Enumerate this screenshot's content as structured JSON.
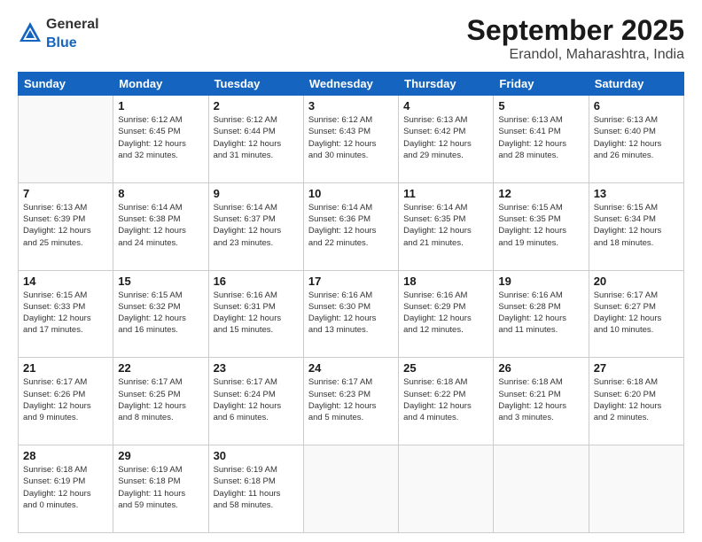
{
  "header": {
    "logo_general": "General",
    "logo_blue": "Blue",
    "title": "September 2025",
    "subtitle": "Erandol, Maharashtra, India"
  },
  "days_of_week": [
    "Sunday",
    "Monday",
    "Tuesday",
    "Wednesday",
    "Thursday",
    "Friday",
    "Saturday"
  ],
  "weeks": [
    [
      {
        "day": "",
        "info": ""
      },
      {
        "day": "1",
        "info": "Sunrise: 6:12 AM\nSunset: 6:45 PM\nDaylight: 12 hours\nand 32 minutes."
      },
      {
        "day": "2",
        "info": "Sunrise: 6:12 AM\nSunset: 6:44 PM\nDaylight: 12 hours\nand 31 minutes."
      },
      {
        "day": "3",
        "info": "Sunrise: 6:12 AM\nSunset: 6:43 PM\nDaylight: 12 hours\nand 30 minutes."
      },
      {
        "day": "4",
        "info": "Sunrise: 6:13 AM\nSunset: 6:42 PM\nDaylight: 12 hours\nand 29 minutes."
      },
      {
        "day": "5",
        "info": "Sunrise: 6:13 AM\nSunset: 6:41 PM\nDaylight: 12 hours\nand 28 minutes."
      },
      {
        "day": "6",
        "info": "Sunrise: 6:13 AM\nSunset: 6:40 PM\nDaylight: 12 hours\nand 26 minutes."
      }
    ],
    [
      {
        "day": "7",
        "info": "Sunrise: 6:13 AM\nSunset: 6:39 PM\nDaylight: 12 hours\nand 25 minutes."
      },
      {
        "day": "8",
        "info": "Sunrise: 6:14 AM\nSunset: 6:38 PM\nDaylight: 12 hours\nand 24 minutes."
      },
      {
        "day": "9",
        "info": "Sunrise: 6:14 AM\nSunset: 6:37 PM\nDaylight: 12 hours\nand 23 minutes."
      },
      {
        "day": "10",
        "info": "Sunrise: 6:14 AM\nSunset: 6:36 PM\nDaylight: 12 hours\nand 22 minutes."
      },
      {
        "day": "11",
        "info": "Sunrise: 6:14 AM\nSunset: 6:35 PM\nDaylight: 12 hours\nand 21 minutes."
      },
      {
        "day": "12",
        "info": "Sunrise: 6:15 AM\nSunset: 6:35 PM\nDaylight: 12 hours\nand 19 minutes."
      },
      {
        "day": "13",
        "info": "Sunrise: 6:15 AM\nSunset: 6:34 PM\nDaylight: 12 hours\nand 18 minutes."
      }
    ],
    [
      {
        "day": "14",
        "info": "Sunrise: 6:15 AM\nSunset: 6:33 PM\nDaylight: 12 hours\nand 17 minutes."
      },
      {
        "day": "15",
        "info": "Sunrise: 6:15 AM\nSunset: 6:32 PM\nDaylight: 12 hours\nand 16 minutes."
      },
      {
        "day": "16",
        "info": "Sunrise: 6:16 AM\nSunset: 6:31 PM\nDaylight: 12 hours\nand 15 minutes."
      },
      {
        "day": "17",
        "info": "Sunrise: 6:16 AM\nSunset: 6:30 PM\nDaylight: 12 hours\nand 13 minutes."
      },
      {
        "day": "18",
        "info": "Sunrise: 6:16 AM\nSunset: 6:29 PM\nDaylight: 12 hours\nand 12 minutes."
      },
      {
        "day": "19",
        "info": "Sunrise: 6:16 AM\nSunset: 6:28 PM\nDaylight: 12 hours\nand 11 minutes."
      },
      {
        "day": "20",
        "info": "Sunrise: 6:17 AM\nSunset: 6:27 PM\nDaylight: 12 hours\nand 10 minutes."
      }
    ],
    [
      {
        "day": "21",
        "info": "Sunrise: 6:17 AM\nSunset: 6:26 PM\nDaylight: 12 hours\nand 9 minutes."
      },
      {
        "day": "22",
        "info": "Sunrise: 6:17 AM\nSunset: 6:25 PM\nDaylight: 12 hours\nand 8 minutes."
      },
      {
        "day": "23",
        "info": "Sunrise: 6:17 AM\nSunset: 6:24 PM\nDaylight: 12 hours\nand 6 minutes."
      },
      {
        "day": "24",
        "info": "Sunrise: 6:17 AM\nSunset: 6:23 PM\nDaylight: 12 hours\nand 5 minutes."
      },
      {
        "day": "25",
        "info": "Sunrise: 6:18 AM\nSunset: 6:22 PM\nDaylight: 12 hours\nand 4 minutes."
      },
      {
        "day": "26",
        "info": "Sunrise: 6:18 AM\nSunset: 6:21 PM\nDaylight: 12 hours\nand 3 minutes."
      },
      {
        "day": "27",
        "info": "Sunrise: 6:18 AM\nSunset: 6:20 PM\nDaylight: 12 hours\nand 2 minutes."
      }
    ],
    [
      {
        "day": "28",
        "info": "Sunrise: 6:18 AM\nSunset: 6:19 PM\nDaylight: 12 hours\nand 0 minutes."
      },
      {
        "day": "29",
        "info": "Sunrise: 6:19 AM\nSunset: 6:18 PM\nDaylight: 11 hours\nand 59 minutes."
      },
      {
        "day": "30",
        "info": "Sunrise: 6:19 AM\nSunset: 6:18 PM\nDaylight: 11 hours\nand 58 minutes."
      },
      {
        "day": "",
        "info": ""
      },
      {
        "day": "",
        "info": ""
      },
      {
        "day": "",
        "info": ""
      },
      {
        "day": "",
        "info": ""
      }
    ]
  ]
}
